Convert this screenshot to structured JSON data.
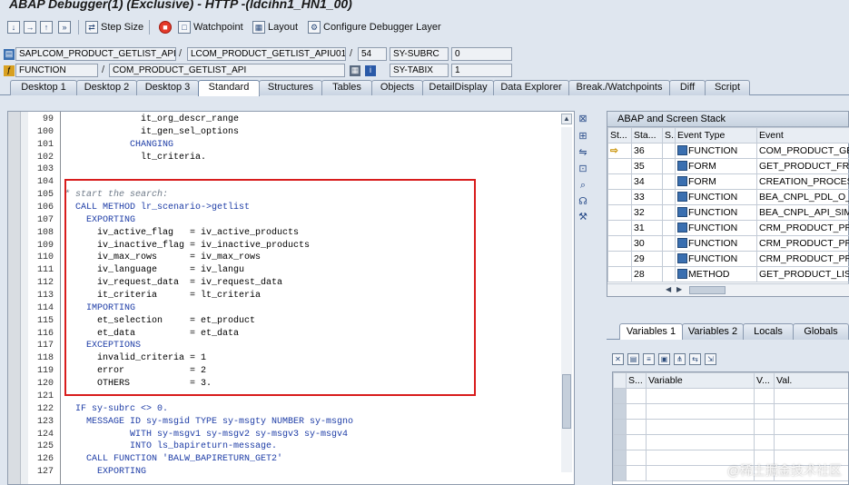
{
  "window": {
    "title": "ABAP Debugger(1)  (Exclusive) - HTTP -(ldcihn1_HN1_00)"
  },
  "toolbar": {
    "step_size": "Step Size",
    "watchpoint": "Watchpoint",
    "layout": "Layout",
    "configure": "Configure Debugger Layer"
  },
  "fields": {
    "row1": {
      "program": "SAPLCOM_PRODUCT_GETLIST_API",
      "include": "LCOM_PRODUCT_GETLIST_APIU01",
      "line": "54",
      "sysvar": "SY-SUBRC",
      "sysval": "0"
    },
    "row2": {
      "type": "FUNCTION",
      "name": "COM_PRODUCT_GETLIST_API",
      "sysvar": "SY-TABIX",
      "sysval": "1"
    }
  },
  "tabs": [
    "Desktop 1",
    "Desktop 2",
    "Desktop 3",
    "Standard",
    "Structures",
    "Tables",
    "Objects",
    "DetailDisplay",
    "Data Explorer",
    "Break./Watchpoints",
    "Diff",
    "Script"
  ],
  "code_lines": [
    {
      "n": "99",
      "t": "              it_org_descr_range"
    },
    {
      "n": "100",
      "t": "              it_gen_sel_options"
    },
    {
      "n": "101",
      "t": "            CHANGING"
    },
    {
      "n": "102",
      "t": "              lt_criteria."
    },
    {
      "n": "103",
      "t": ""
    },
    {
      "n": "104",
      "t": ""
    },
    {
      "n": "105",
      "t": "* start the search:"
    },
    {
      "n": "106",
      "t": "  CALL METHOD lr_scenario->getlist"
    },
    {
      "n": "107",
      "t": "    EXPORTING"
    },
    {
      "n": "108",
      "t": "      iv_active_flag   = iv_active_products"
    },
    {
      "n": "109",
      "t": "      iv_inactive_flag = iv_inactive_products"
    },
    {
      "n": "110",
      "t": "      iv_max_rows      = iv_max_rows"
    },
    {
      "n": "111",
      "t": "      iv_language      = iv_langu"
    },
    {
      "n": "112",
      "t": "      iv_request_data  = iv_request_data"
    },
    {
      "n": "113",
      "t": "      it_criteria      = lt_criteria"
    },
    {
      "n": "114",
      "t": "    IMPORTING"
    },
    {
      "n": "115",
      "t": "      et_selection     = et_product"
    },
    {
      "n": "116",
      "t": "      et_data          = et_data"
    },
    {
      "n": "117",
      "t": "    EXCEPTIONS"
    },
    {
      "n": "118",
      "t": "      invalid_criteria = 1"
    },
    {
      "n": "119",
      "t": "      error            = 2"
    },
    {
      "n": "120",
      "t": "      OTHERS           = 3."
    },
    {
      "n": "121",
      "t": ""
    },
    {
      "n": "122",
      "t": "  IF sy-subrc <> 0."
    },
    {
      "n": "123",
      "t": "    MESSAGE ID sy-msgid TYPE sy-msgty NUMBER sy-msgno"
    },
    {
      "n": "124",
      "t": "            WITH sy-msgv1 sy-msgv2 sy-msgv3 sy-msgv4"
    },
    {
      "n": "125",
      "t": "            INTO ls_bapireturn-message."
    },
    {
      "n": "126",
      "t": "    CALL FUNCTION 'BALW_BAPIRETURN_GET2'"
    },
    {
      "n": "127",
      "t": "      EXPORTING"
    }
  ],
  "stack": {
    "title": "ABAP and Screen Stack",
    "headers": [
      "St...",
      "Sta...",
      "S...",
      "Event Type",
      "Event"
    ],
    "rows": [
      {
        "level": "36",
        "type": "FUNCTION",
        "event": "COM_PRODUCT_GETLI",
        "current": true
      },
      {
        "level": "35",
        "type": "FORM",
        "event": "GET_PRODUCT_FROM_"
      },
      {
        "level": "34",
        "type": "FORM",
        "event": "CREATION_PROCESS"
      },
      {
        "level": "33",
        "type": "FUNCTION",
        "event": "BEA_CNPL_PDL_O_DA"
      },
      {
        "level": "32",
        "type": "FUNCTION",
        "event": "BEA_CNPL_API_SIMUL"
      },
      {
        "level": "31",
        "type": "FUNCTION",
        "event": "CRM_PRODUCT_PROPC"
      },
      {
        "level": "30",
        "type": "FUNCTION",
        "event": "CRM_PRODUCT_PROPC"
      },
      {
        "level": "29",
        "type": "FUNCTION",
        "event": "CRM_PRODUCT_PROPC"
      },
      {
        "level": "28",
        "type": "METHOD",
        "event": "GET_PRODUCT_LIST"
      }
    ]
  },
  "var_tabs": [
    "Variables 1",
    "Variables 2",
    "Locals",
    "Globals"
  ],
  "var_grid": {
    "headers": [
      "S...",
      "Variable",
      "V...",
      "Val."
    ]
  },
  "watermark": "@稀土掘金技术社区"
}
